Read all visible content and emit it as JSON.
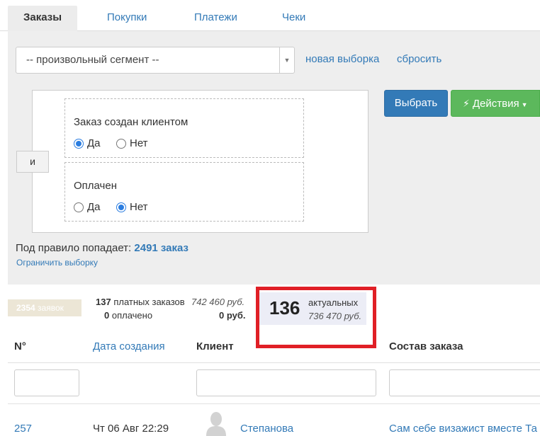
{
  "tabs": [
    {
      "label": "Заказы",
      "active": true
    },
    {
      "label": "Покупки",
      "active": false
    },
    {
      "label": "Платежи",
      "active": false
    },
    {
      "label": "Чеки",
      "active": false
    }
  ],
  "filter": {
    "segment_value": "-- произвольный сегмент --",
    "new_selection_label": "новая выборка",
    "reset_label": "сбросить",
    "and_label": "и",
    "conditions": [
      {
        "title": "Заказ создан клиентом",
        "options": [
          {
            "label": "Да",
            "checked": true
          },
          {
            "label": "Нет",
            "checked": false
          }
        ]
      },
      {
        "title": "Оплачен",
        "options": [
          {
            "label": "Да",
            "checked": false
          },
          {
            "label": "Нет",
            "checked": true
          }
        ]
      }
    ],
    "select_button": "Выбрать",
    "actions_button": "Действия",
    "rule_count_prefix": "Под правило попадает:",
    "rule_count_value": "2491 заказ",
    "limit_label": "Ограничить выборку"
  },
  "stats": {
    "requests_count": "2354",
    "requests_label": "заявок",
    "paid_count": "137",
    "paid_label": "платных заказов",
    "paid_sum": "742 460 руб.",
    "paid_done_count": "0",
    "paid_done_label": "оплачено",
    "paid_done_sum": "0 руб.",
    "actual_count": "136",
    "actual_label": "актуальных",
    "actual_sum": "736 470 руб."
  },
  "table": {
    "headers": [
      "N°",
      "Дата создания",
      "Клиент",
      "Состав заказа"
    ],
    "rows": [
      {
        "number": "257",
        "date": "Чт 06 Авг 22:29",
        "client": "Степанова",
        "composition": "Сам себе визажист вместе Та"
      }
    ]
  },
  "colors": {
    "accent": "#337ab7",
    "success": "#5cb85c",
    "highlight": "#e01f26"
  }
}
